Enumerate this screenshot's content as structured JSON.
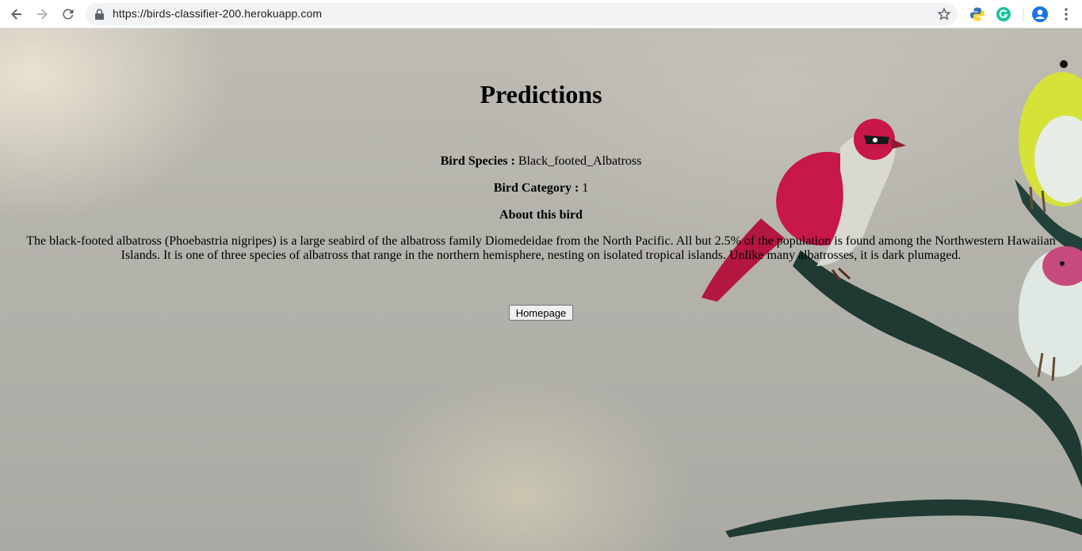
{
  "browser": {
    "url": "https://birds-classifier-200.herokuapp.com",
    "icons": [
      "back-icon",
      "forward-icon",
      "reload-icon",
      "lock-icon",
      "star-icon",
      "python-extension-icon",
      "grammarly-extension-icon",
      "profile-avatar-icon",
      "kebab-menu-icon"
    ]
  },
  "page": {
    "title": "Predictions",
    "species_label": "Bird Species :",
    "species_value": "Black_footed_Albatross",
    "category_label": "Bird Category :",
    "category_value": "1",
    "about_heading": "About this bird",
    "description": "The black-footed albatross (Phoebastria nigripes) is a large seabird of the albatross family Diomedeidae from the North Pacific. All but 2.5% of the population is found among the Northwestern Hawaiian Islands. It is one of three species of albatross that range in the northern hemisphere, nesting on isolated tropical islands. Unlike many albatrosses, it is dark plumaged.",
    "homepage_button": "Homepage"
  },
  "colors": {
    "page_background": "#b3b2ab",
    "red_bird": "#c8174a",
    "green_bird": "#d4e23a",
    "branch": "#1f3a33"
  }
}
